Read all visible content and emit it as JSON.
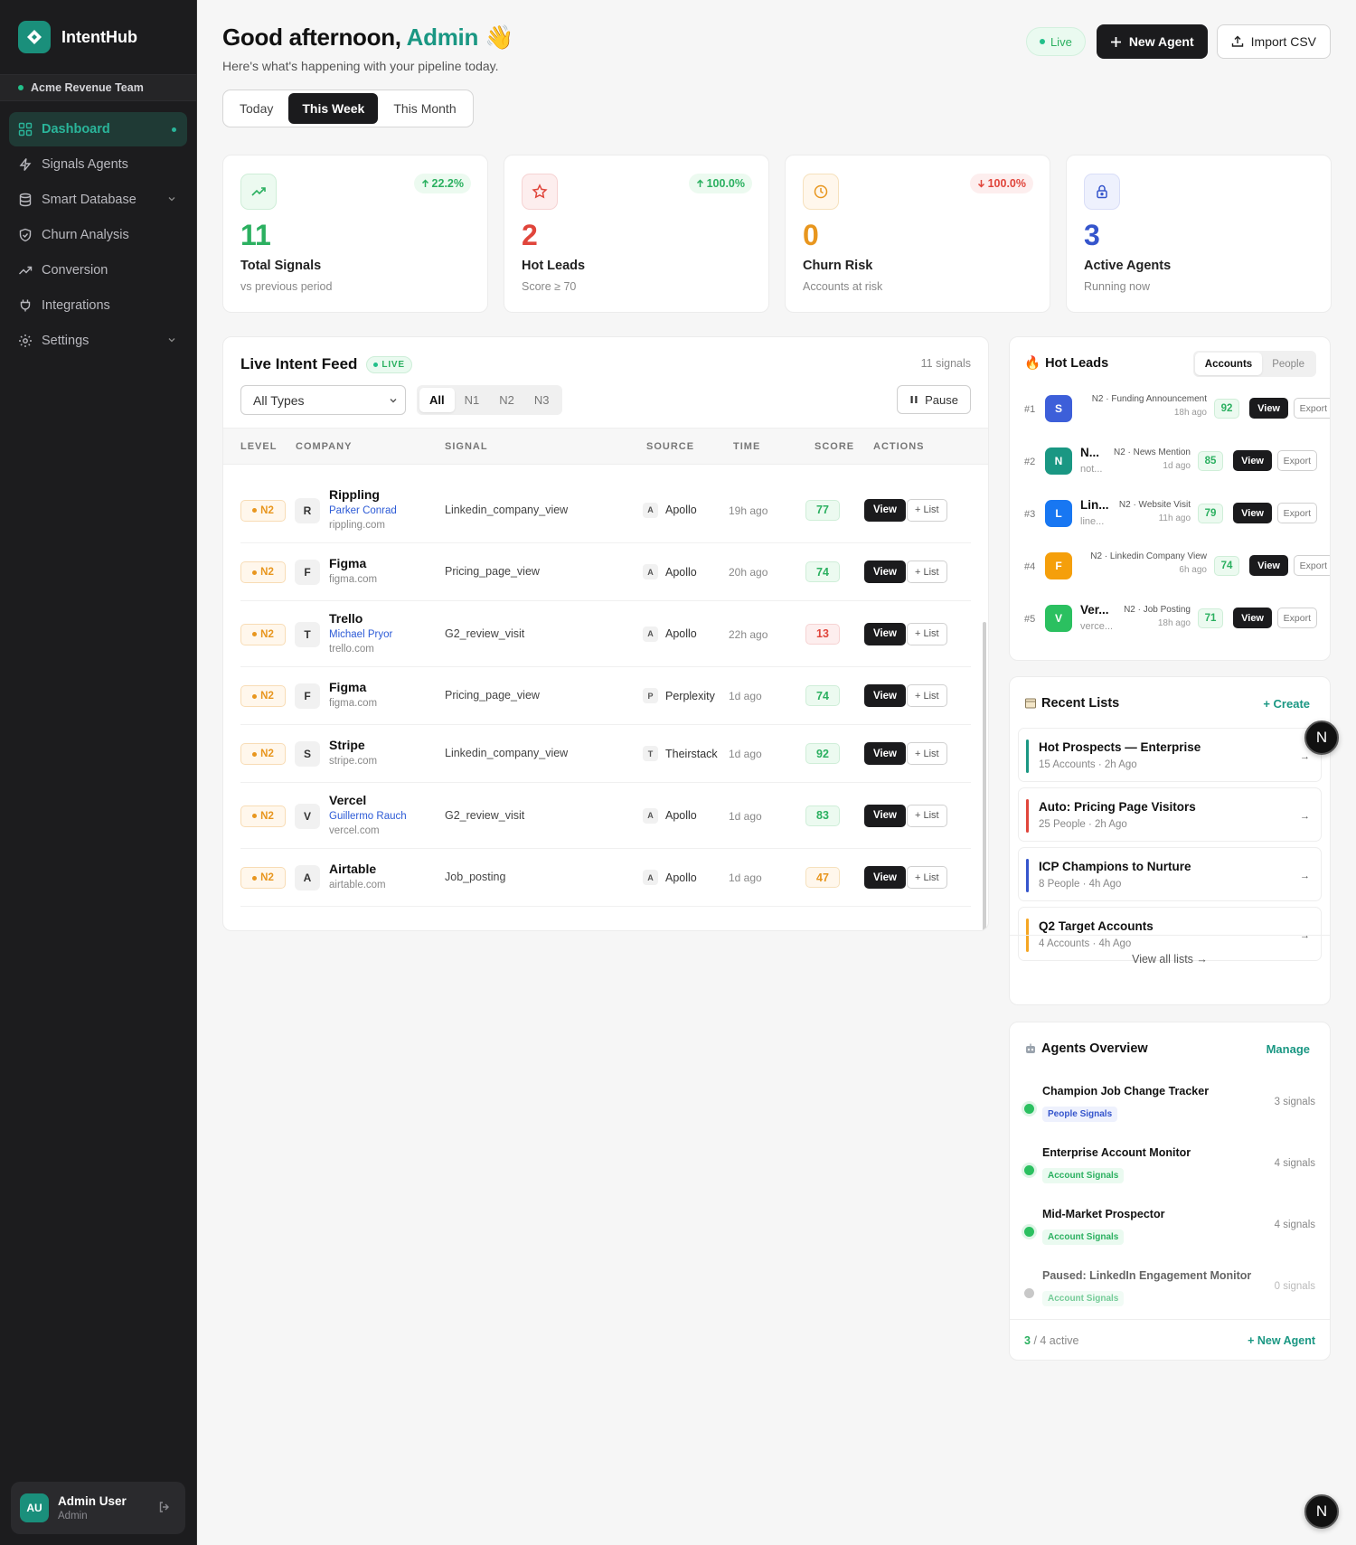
{
  "app": {
    "name": "IntentHub",
    "team": "Acme Revenue Team"
  },
  "nav": [
    {
      "label": "Dashboard",
      "icon": "grid-icon",
      "active": true
    },
    {
      "label": "Signals Agents",
      "icon": "bolt-icon"
    },
    {
      "label": "Smart Database",
      "icon": "database-icon",
      "expandable": true
    },
    {
      "label": "Churn Analysis",
      "icon": "shield-icon"
    },
    {
      "label": "Conversion",
      "icon": "trend-icon"
    },
    {
      "label": "Integrations",
      "icon": "plug-icon"
    },
    {
      "label": "Settings",
      "icon": "gear-icon",
      "expandable": true
    }
  ],
  "user": {
    "initials": "AU",
    "name": "Admin User",
    "role": "Admin"
  },
  "header": {
    "greeting": "Good afternoon,",
    "name": "Admin",
    "wave": "👋",
    "subtitle": "Here's what's happening with your pipeline today.",
    "live": "Live",
    "new_agent": "New Agent",
    "import_csv": "Import CSV"
  },
  "range": {
    "options": [
      "Today",
      "This Week",
      "This Month"
    ],
    "selected": "This Week"
  },
  "stats": [
    {
      "value": "11",
      "label": "Total Signals",
      "caption": "vs previous period",
      "change": "22.2%",
      "direction": "up",
      "color": "#2bb060",
      "icon": "trend-up-icon"
    },
    {
      "value": "2",
      "label": "Hot Leads",
      "caption": "Score ≥ 70",
      "change": "100.0%",
      "direction": "up",
      "color": "#e0453b",
      "icon": "star-icon"
    },
    {
      "value": "0",
      "label": "Churn Risk",
      "caption": "Accounts at risk",
      "change": "100.0%",
      "direction": "down",
      "color": "#e8961e",
      "icon": "clock-icon"
    },
    {
      "value": "3",
      "label": "Active Agents",
      "caption": "Running now",
      "change": "",
      "direction": "",
      "color": "#3555cc",
      "icon": "lock-icon"
    }
  ],
  "feed": {
    "title": "Live Intent Feed",
    "live_tag": "LIVE",
    "count": "11 signals",
    "filter": "All Types",
    "levels": [
      "All",
      "N1",
      "N2",
      "N3"
    ],
    "level_selected": "All",
    "pause": "Pause",
    "columns": [
      "LEVEL",
      "COMPANY",
      "SIGNAL",
      "SOURCE",
      "TIME",
      "SCORE",
      "ACTIONS"
    ],
    "view_label": "View",
    "list_label": "+ List",
    "rows": [
      {
        "level": "N2",
        "initial": "R",
        "company": "Rippling",
        "person": "Parker Conrad",
        "domain": "rippling.com",
        "signal": "Linkedin_company_view",
        "source_initial": "A",
        "source": "Apollo",
        "time": "19h ago",
        "score": "77",
        "tone": "green"
      },
      {
        "level": "N2",
        "initial": "F",
        "company": "Figma",
        "person": "",
        "domain": "figma.com",
        "signal": "Pricing_page_view",
        "source_initial": "A",
        "source": "Apollo",
        "time": "20h ago",
        "score": "74",
        "tone": "green"
      },
      {
        "level": "N2",
        "initial": "T",
        "company": "Trello",
        "person": "Michael Pryor",
        "domain": "trello.com",
        "signal": "G2_review_visit",
        "source_initial": "A",
        "source": "Apollo",
        "time": "22h ago",
        "score": "13",
        "tone": "red"
      },
      {
        "level": "N2",
        "initial": "F",
        "company": "Figma",
        "person": "",
        "domain": "figma.com",
        "signal": "Pricing_page_view",
        "source_initial": "P",
        "source": "Perplexity",
        "time": "1d ago",
        "score": "74",
        "tone": "green"
      },
      {
        "level": "N2",
        "initial": "S",
        "company": "Stripe",
        "person": "",
        "domain": "stripe.com",
        "signal": "Linkedin_company_view",
        "source_initial": "T",
        "source": "Theirstack",
        "time": "1d ago",
        "score": "92",
        "tone": "green"
      },
      {
        "level": "N2",
        "initial": "V",
        "company": "Vercel",
        "person": "Guillermo Rauch",
        "domain": "vercel.com",
        "signal": "G2_review_visit",
        "source_initial": "A",
        "source": "Apollo",
        "time": "1d ago",
        "score": "83",
        "tone": "green"
      },
      {
        "level": "N2",
        "initial": "A",
        "company": "Airtable",
        "person": "",
        "domain": "airtable.com",
        "signal": "Job_posting",
        "source_initial": "A",
        "source": "Apollo",
        "time": "1d ago",
        "score": "47",
        "tone": "orange"
      }
    ]
  },
  "hot_leads": {
    "title": "Hot Leads",
    "emoji": "🔥",
    "tabs": [
      "Accounts",
      "People"
    ],
    "tab_selected": "Accounts",
    "view_label": "View",
    "export_label": "Export",
    "items": [
      {
        "rank": "#1",
        "initial": "S",
        "color": "#3d5fd9",
        "name": "",
        "domain": "",
        "signal": "N2 · Funding Announcement",
        "time": "18h ago",
        "score": "92"
      },
      {
        "rank": "#2",
        "initial": "N",
        "color": "#1a9783",
        "name": "N...",
        "domain": "not...",
        "signal": "N2 · News Mention",
        "time": "1d ago",
        "score": "85"
      },
      {
        "rank": "#3",
        "initial": "L",
        "color": "#1877f2",
        "name": "Lin...",
        "domain": "line...",
        "signal": "N2 · Website Visit",
        "time": "11h ago",
        "score": "79"
      },
      {
        "rank": "#4",
        "initial": "F",
        "color": "#f59f0b",
        "name": "",
        "domain": "",
        "signal": "N2 · Linkedin Company View",
        "time": "6h ago",
        "score": "74"
      },
      {
        "rank": "#5",
        "initial": "V",
        "color": "#2bc060",
        "name": "Ver...",
        "domain": "verce...",
        "signal": "N2 · Job Posting",
        "time": "18h ago",
        "score": "71"
      }
    ]
  },
  "recent_lists": {
    "title": "Recent Lists",
    "create": "+ Create",
    "view_all": "View all lists →",
    "items": [
      {
        "name": "Hot Prospects — Enterprise",
        "meta": "15 Accounts · 2h Ago",
        "color": "#1a9783"
      },
      {
        "name": "Auto: Pricing Page Visitors",
        "meta": "25 People · 2h Ago",
        "color": "#e0453b"
      },
      {
        "name": "ICP Champions to Nurture",
        "meta": "8 People · 4h Ago",
        "color": "#3555cc"
      },
      {
        "name": "Q2 Target Accounts",
        "meta": "4 Accounts · 4h Ago",
        "color": "#f5a623"
      }
    ]
  },
  "agents": {
    "title": "Agents Overview",
    "manage": "Manage",
    "footer_active": "3",
    "footer_rest": "/ 4 active",
    "new_agent": "+ New Agent",
    "items": [
      {
        "name": "Champion Job Change Tracker",
        "tag": "People Signals",
        "type": "people",
        "count": "3 signals",
        "active": true
      },
      {
        "name": "Enterprise Account Monitor",
        "tag": "Account Signals",
        "type": "account",
        "count": "4 signals",
        "active": true
      },
      {
        "name": "Mid-Market Prospector",
        "tag": "Account Signals",
        "type": "account",
        "count": "4 signals",
        "active": true
      },
      {
        "name": "Paused: LinkedIn Engagement Monitor",
        "tag": "Account Signals",
        "type": "account",
        "count": "0 signals",
        "active": false
      }
    ]
  },
  "badge": "N"
}
